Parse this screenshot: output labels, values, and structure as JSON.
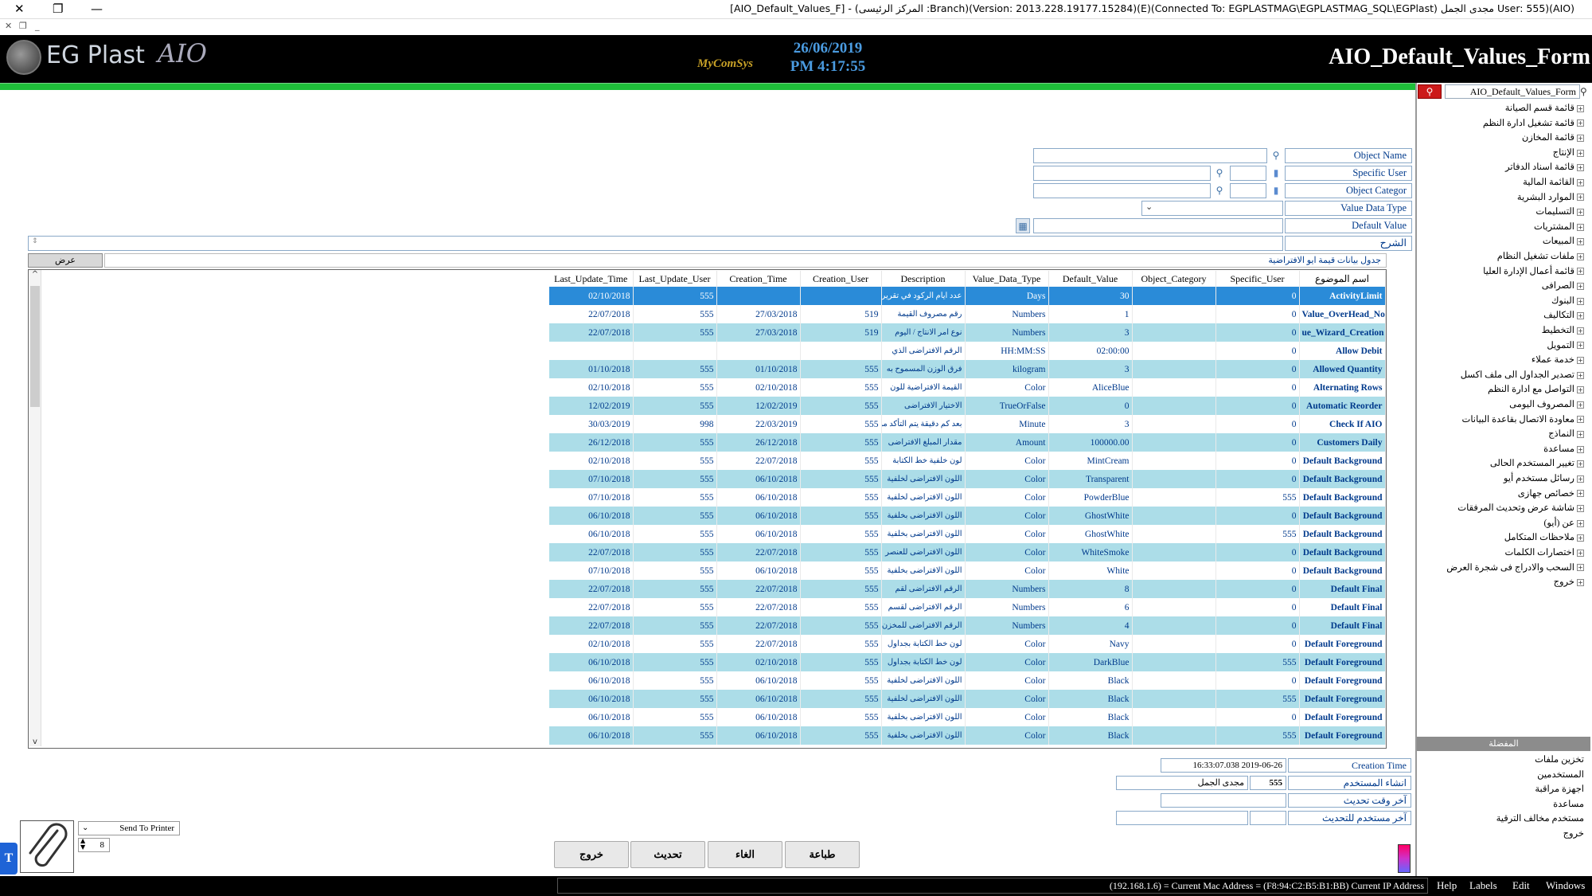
{
  "window": {
    "title": "[AIO_Default_Values_F] - (المركز الرئيسى :Branch)(Version: 2013.228.19177.15284)(E)(Connected To: EGPLASTMAG\\EGPLASTMAG_SQL\\EGPlast) مجدى الجمل User: 555)(AIO)",
    "close_icon": "close-icon",
    "restore_icon": "restore-icon",
    "minimize_icon": "minimize-icon"
  },
  "header": {
    "brand": "EG Plast",
    "brand_suffix": "AIO",
    "company_logo_text": "MyComSys",
    "date": "26/06/2019",
    "time": "PM 4:17:55",
    "form_title": "AIO_Default_Values_Form"
  },
  "colors": {
    "header_bg": "#000000",
    "accent_green": "#1fbf3a",
    "row_alt": "#acdde8",
    "row_selected": "#2a8bd8",
    "text_blue": "#003a8c"
  },
  "right_panel": {
    "search_value": "AIO_Default_Values_Form",
    "tree_items": [
      "قائمة قسم الصيانة",
      "قائمة تشغيل ادارة النظم",
      "قائمة المخازن",
      "الإنتاج",
      "قائمة اسناد الدفاتر",
      "القائمة المالية",
      "الموارد البشرية",
      "التسليمات",
      "المشتريات",
      "المبيعات",
      "ملفات تشغيل النظام",
      "قائمة أعمال الإدارة العليا",
      "الصرافى",
      "البنوك",
      "التكاليف",
      "التخطيط",
      "التمويل",
      "خدمة عملاء",
      "تصدير الجداول الى ملف اكسل",
      "التواصل مع ادارة النظم",
      "المصروف اليومى",
      "معاودة الاتصال بقاعدة البيانات",
      "النماذج",
      "مساعدة",
      "تغيير المستخدم الحالى",
      "رسائل مستخدم أيو",
      "خصائص جهازى",
      "شاشة عرض وتحديث المرفقات",
      "عن (أيو)",
      "ملاحظات المتكامل",
      "اختصارات الكلمات",
      "السحب والادراج فى شجرة العرض",
      "خروج"
    ],
    "favorites_header": "المفضلة",
    "favorites": [
      "تخزين ملفات",
      "المستخدمين",
      "اجهزة مراقبة",
      "مساعدة",
      "مستخدم مخالف الترقية",
      "خروج"
    ]
  },
  "form": {
    "object_name_label": "Object Name",
    "specific_user_label": "Specific User",
    "object_category_label": "Object Categor",
    "value_data_type_label": "Value Data Type",
    "default_value_label": "Default Value",
    "explanation_label": "الشرح",
    "grid_title": "جدول بيانات قيمة ايو الافتراضية",
    "show_button": "عرض"
  },
  "grid": {
    "columns": [
      "Last_Update_Time",
      "Last_Update_User",
      "Creation_Time",
      "Creation_User",
      "Description",
      "Value_Data_Type",
      "Default_Value",
      "Object_Category",
      "Specific_User",
      "اسم الموضوع"
    ],
    "rows": [
      [
        "02/10/2018",
        "555",
        "",
        "",
        "عدد ايام الركود في تقرير",
        "Days",
        "30",
        "",
        "0",
        "ActivityLimit"
      ],
      [
        "22/07/2018",
        "555",
        "27/03/2018",
        "519",
        "رقم مصروف القيمة",
        "Numbers",
        "1",
        "",
        "0",
        "Value_OverHead_No"
      ],
      [
        "22/07/2018",
        "555",
        "27/03/2018",
        "519",
        "نوع امر الانتاج / اليوم",
        "Numbers",
        "3",
        "",
        "0",
        "ue_Wizard_Creation"
      ],
      [
        "",
        "",
        "",
        "",
        "الرقم الافتراضى الذي",
        "HH:MM:SS",
        "02:00:00",
        "",
        "0",
        "Allow Debit"
      ],
      [
        "01/10/2018",
        "555",
        "01/10/2018",
        "555",
        "فرق الوزن المسموح به",
        "kilogram",
        "3",
        "",
        "0",
        "Allowed Quantity"
      ],
      [
        "02/10/2018",
        "555",
        "02/10/2018",
        "555",
        "القيمة الافتراضية للون",
        "Color",
        "AliceBlue",
        "",
        "0",
        "Alternating Rows"
      ],
      [
        "12/02/2019",
        "555",
        "12/02/2019",
        "555",
        "الاختيار الافتراضى",
        "TrueOrFalse",
        "0",
        "",
        "0",
        "Automatic Reorder"
      ],
      [
        "30/03/2019",
        "998",
        "22/03/2019",
        "555",
        "بعد كم دقيقة يتم التأكد من",
        "Minute",
        "3",
        "",
        "0",
        "Check If AIO"
      ],
      [
        "26/12/2018",
        "555",
        "26/12/2018",
        "555",
        "مقدار المبلغ الافتراضى",
        "Amount",
        "100000.00",
        "",
        "0",
        "Customers Daily"
      ],
      [
        "02/10/2018",
        "555",
        "22/07/2018",
        "555",
        "لون خلفية خط الكتابة",
        "Color",
        "MintCream",
        "",
        "0",
        "Default Background"
      ],
      [
        "07/10/2018",
        "555",
        "06/10/2018",
        "555",
        "اللون الافتراضى لخلفية",
        "Color",
        "Transparent",
        "",
        "0",
        "Default Background"
      ],
      [
        "07/10/2018",
        "555",
        "06/10/2018",
        "555",
        "اللون الافتراضى لخلفية",
        "Color",
        "PowderBlue",
        "",
        "555",
        "Default Background"
      ],
      [
        "06/10/2018",
        "555",
        "06/10/2018",
        "555",
        "اللون الافتراضى بخلفية",
        "Color",
        "GhostWhite",
        "",
        "0",
        "Default Background"
      ],
      [
        "06/10/2018",
        "555",
        "06/10/2018",
        "555",
        "اللون الافتراضى بخلفية",
        "Color",
        "GhostWhite",
        "",
        "555",
        "Default Background"
      ],
      [
        "22/07/2018",
        "555",
        "22/07/2018",
        "555",
        "اللون الافتراضى للعنصر",
        "Color",
        "WhiteSmoke",
        "",
        "0",
        "Default Background"
      ],
      [
        "07/10/2018",
        "555",
        "06/10/2018",
        "555",
        "اللون الافتراضى بخلفية",
        "Color",
        "White",
        "",
        "0",
        "Default Background"
      ],
      [
        "22/07/2018",
        "555",
        "22/07/2018",
        "555",
        "الرقم الافتراضى لقم",
        "Numbers",
        "8",
        "",
        "0",
        "Default Final"
      ],
      [
        "22/07/2018",
        "555",
        "22/07/2018",
        "555",
        "الرقم الافتراضى لقسم",
        "Numbers",
        "6",
        "",
        "0",
        "Default Final"
      ],
      [
        "22/07/2018",
        "555",
        "22/07/2018",
        "555",
        "الرقم الافتراضى للمخزن",
        "Numbers",
        "4",
        "",
        "0",
        "Default Final"
      ],
      [
        "02/10/2018",
        "555",
        "22/07/2018",
        "555",
        "لون خط الكتابة بجداول",
        "Color",
        "Navy",
        "",
        "0",
        "Default Foreground"
      ],
      [
        "06/10/2018",
        "555",
        "02/10/2018",
        "555",
        "لون خط الكتابة بجداول",
        "Color",
        "DarkBlue",
        "",
        "555",
        "Default Foreground"
      ],
      [
        "06/10/2018",
        "555",
        "06/10/2018",
        "555",
        "اللون الافتراضى لخلفية",
        "Color",
        "Black",
        "",
        "0",
        "Default Foreground"
      ],
      [
        "06/10/2018",
        "555",
        "06/10/2018",
        "555",
        "اللون الافتراضى لخلفية",
        "Color",
        "Black",
        "",
        "555",
        "Default Foreground"
      ],
      [
        "06/10/2018",
        "555",
        "06/10/2018",
        "555",
        "اللون الافتراضى بخلفية",
        "Color",
        "Black",
        "",
        "0",
        "Default Foreground"
      ],
      [
        "06/10/2018",
        "555",
        "06/10/2018",
        "555",
        "اللون الافتراضى بخلفية",
        "Color",
        "Black",
        "",
        "555",
        "Default Foreground"
      ]
    ]
  },
  "info": {
    "creation_time_label": "Creation Time",
    "creation_time_value": "16:33:07.038 2019-06-26",
    "created_by_label": "انشاء المستخدم",
    "created_by_id": "555",
    "created_by_name": "مجدى الجمل",
    "last_update_time_label": "آخر وقت تحديث",
    "last_update_user_label": "آخر مستخدم للتحديث"
  },
  "print": {
    "printer_option": "Send To Printer",
    "copies": "8"
  },
  "actions": {
    "exit": "خروج",
    "refresh": "تحديث",
    "cancel": "الغاء",
    "print": "طباعة"
  },
  "status": {
    "network": "(192.168.1.6) = Current Mac Address = (F8:94:C2:B5:B1:BB) Current IP Address",
    "menu": [
      "Help",
      "Labels",
      "Edit",
      "Windows"
    ]
  }
}
